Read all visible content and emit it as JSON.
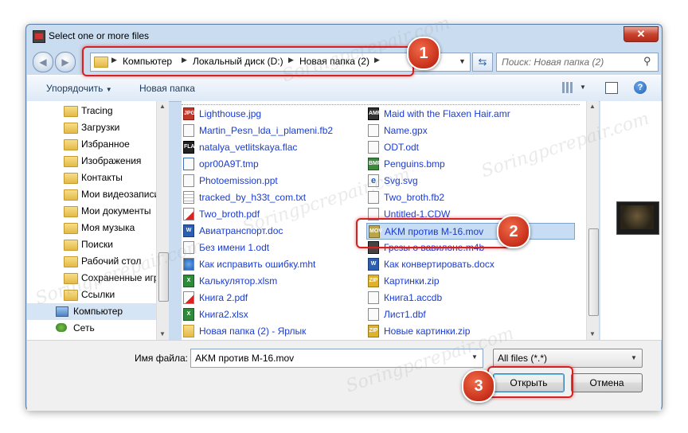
{
  "window": {
    "title": "Select one or more files",
    "close_symbol": "✕"
  },
  "address": {
    "crumbs": [
      "Компьютер",
      "Локальный диск (D:)",
      "Новая папка (2)"
    ],
    "search_placeholder": "Поиск: Новая папка (2)"
  },
  "toolbar": {
    "organize_label": "Упорядочить",
    "new_folder_label": "Новая папка"
  },
  "sidebar": {
    "items": [
      {
        "label": "Tracing"
      },
      {
        "label": "Загрузки"
      },
      {
        "label": "Избранное"
      },
      {
        "label": "Изображения"
      },
      {
        "label": "Контакты"
      },
      {
        "label": "Мои видеозаписи"
      },
      {
        "label": "Мои документы"
      },
      {
        "label": "Моя музыка"
      },
      {
        "label": "Поиски"
      },
      {
        "label": "Рабочий стол"
      },
      {
        "label": "Сохраненные игры"
      },
      {
        "label": "Ссылки"
      },
      {
        "label": "Компьютер"
      },
      {
        "label": "Сеть"
      }
    ]
  },
  "files": {
    "col1": [
      {
        "name": "Lighthouse.jpg",
        "icon": "jpg-icon",
        "tag": "JPG"
      },
      {
        "name": "Martin_Pesn_lda_i_plameni.fb2",
        "icon": "document-icon",
        "tag": ""
      },
      {
        "name": "natalya_vetlitskaya.flac",
        "icon": "flac-icon",
        "tag": "FLAC"
      },
      {
        "name": "opr00A9T.tmp",
        "icon": "tmp-icon",
        "tag": ""
      },
      {
        "name": "Photoemission.ppt",
        "icon": "document-icon",
        "tag": ""
      },
      {
        "name": "tracked_by_h33t_com.txt",
        "icon": "text-file-icon",
        "tag": ""
      },
      {
        "name": "Two_broth.pdf",
        "icon": "pdf-icon",
        "tag": ""
      },
      {
        "name": "Авиатранспорт.doc",
        "icon": "word-icon",
        "tag": "W"
      },
      {
        "name": "Без имени 1.odt",
        "icon": "document-icon",
        "tag": ""
      },
      {
        "name": "Как исправить ошибку.mht",
        "icon": "mht-icon",
        "tag": ""
      },
      {
        "name": "Калькулятор.xlsm",
        "icon": "excel-icon",
        "tag": "X"
      },
      {
        "name": "Книга 2.pdf",
        "icon": "pdf-icon",
        "tag": ""
      },
      {
        "name": "Книга2.xlsx",
        "icon": "excel-icon",
        "tag": "X"
      },
      {
        "name": "Новая папка (2) - Ярлык",
        "icon": "shortcut-icon",
        "tag": ""
      }
    ],
    "col2": [
      {
        "name": "Maid with the Flaxen Hair.amr",
        "icon": "amr-icon",
        "tag": "AMR"
      },
      {
        "name": "Name.gpx",
        "icon": "document-icon",
        "tag": ""
      },
      {
        "name": "ODT.odt",
        "icon": "document-icon",
        "tag": ""
      },
      {
        "name": "Penguins.bmp",
        "icon": "bmp-icon",
        "tag": "BMP"
      },
      {
        "name": "Svg.svg",
        "icon": "ie-icon",
        "tag": "e"
      },
      {
        "name": "Two_broth.fb2",
        "icon": "document-icon",
        "tag": ""
      },
      {
        "name": "Untitled-1.CDW",
        "icon": "document-icon",
        "tag": ""
      },
      {
        "name": "AKM против M-16.mov",
        "icon": "mov-icon",
        "tag": "MOV"
      },
      {
        "name": "Грезы о вавилоне.m4b",
        "icon": "m4b-icon",
        "tag": ""
      },
      {
        "name": "Как конвертировать.docx",
        "icon": "word-icon",
        "tag": "W"
      },
      {
        "name": "Картинки.zip",
        "icon": "zip-icon",
        "tag": "ZIP"
      },
      {
        "name": "Книга1.accdb",
        "icon": "document-icon",
        "tag": ""
      },
      {
        "name": "Лист1.dbf",
        "icon": "document-icon",
        "tag": ""
      },
      {
        "name": "Новые картинки.zip",
        "icon": "zip-icon",
        "tag": "ZIP"
      }
    ],
    "selected_name": "AKM против M-16.mov"
  },
  "bottom": {
    "filename_label": "Имя файла:",
    "filename_value": "AKM против M-16.mov",
    "filter_value": "All files (*.*)",
    "open_label": "Открыть",
    "cancel_label": "Отмена"
  },
  "callouts": [
    "1",
    "2",
    "3"
  ],
  "watermark_text": "Soringpcrepair.com",
  "colors": {
    "callout_red": "#d42222",
    "file_link_blue": "#1a3cd0",
    "selection": "#c7ddf4"
  }
}
